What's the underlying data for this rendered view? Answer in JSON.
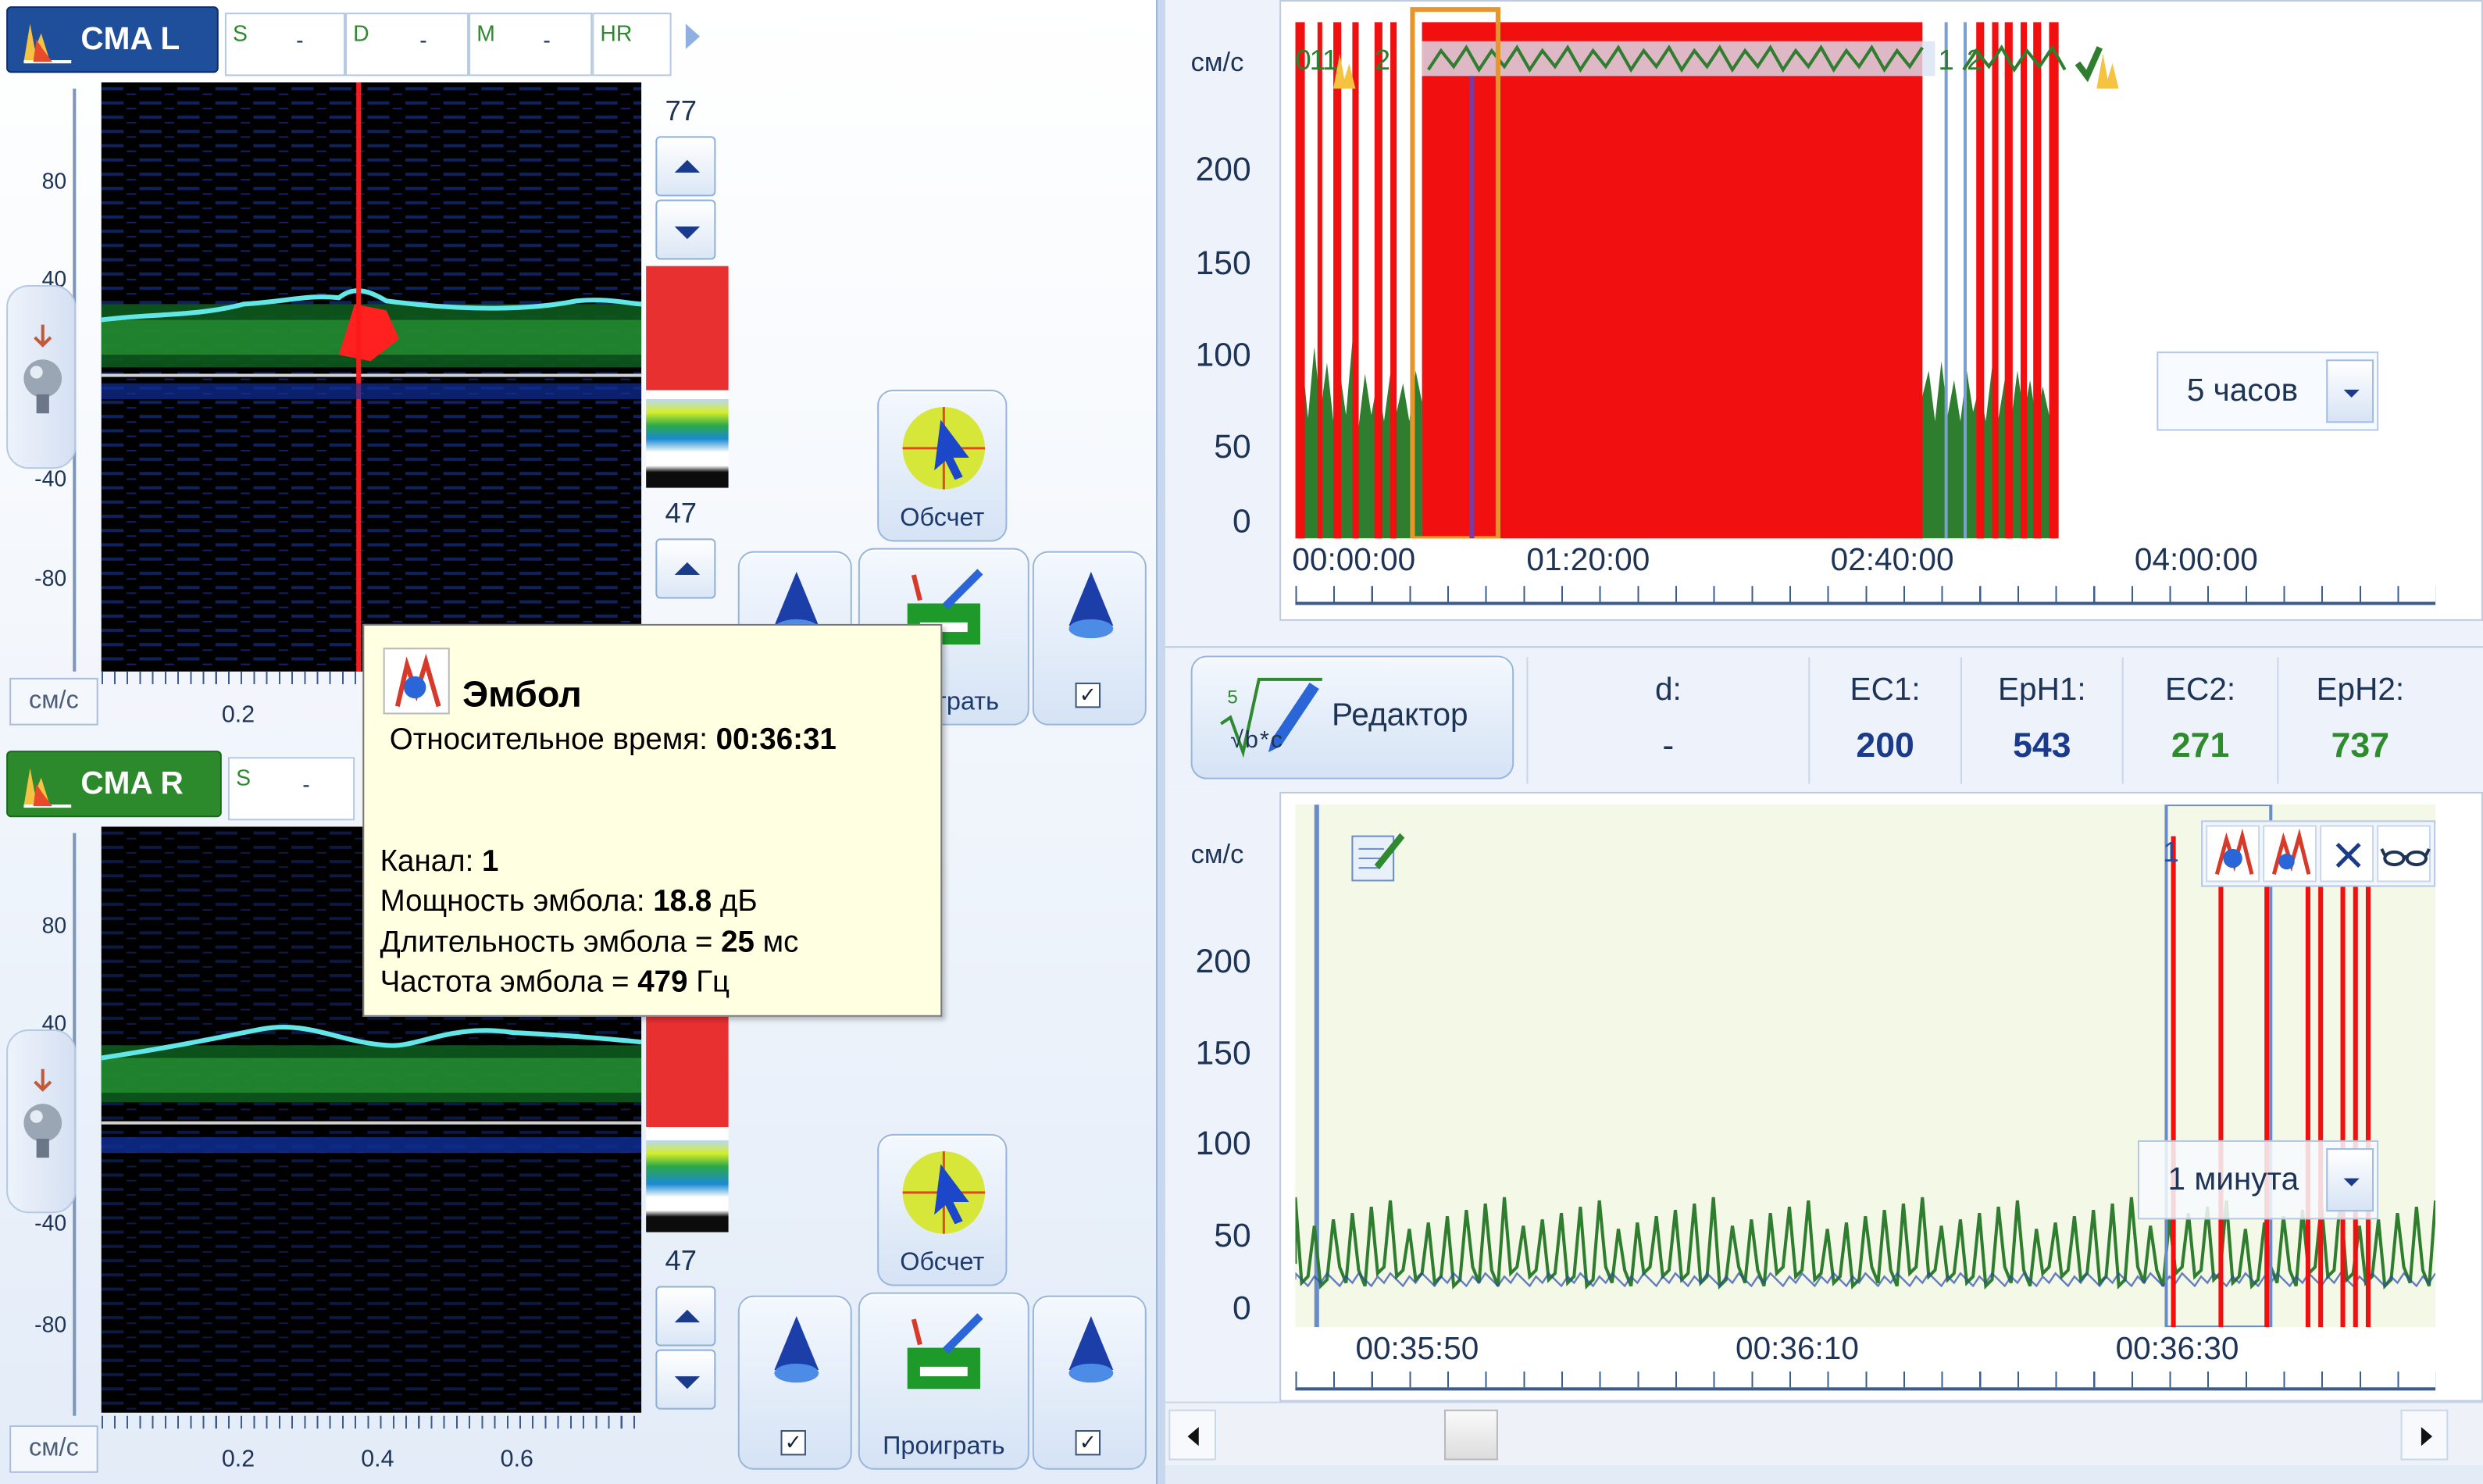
{
  "left": {
    "top_channel": {
      "tab_label": "CMA L",
      "params": [
        {
          "key": "S",
          "value": "-"
        },
        {
          "key": "D",
          "value": "-"
        },
        {
          "key": "M",
          "value": "-"
        },
        {
          "key": "HR",
          "value": ""
        }
      ],
      "y_ticks": [
        "80",
        "40",
        "-40",
        "-80"
      ],
      "x_ticks": [
        "0.2"
      ],
      "unit": "см/с",
      "scale_max": "77",
      "scale_min": "47"
    },
    "bottom_channel": {
      "tab_label": "CMA R",
      "params": [
        {
          "key": "S",
          "value": "-"
        }
      ],
      "y_ticks": [
        "80",
        "40",
        "-40",
        "-80"
      ],
      "x_ticks": [
        "0.2",
        "0.4",
        "0.6"
      ],
      "unit": "см/с",
      "scale_min": "47"
    },
    "buttons": {
      "count_label": "Обсчет",
      "play_label": "Проиграть",
      "play_label_partial": "играть"
    }
  },
  "tooltip": {
    "title": "Эмбол",
    "relative_time_label": "Относительное время:",
    "relative_time_value": "00:36:31",
    "channel_label": "Канал:",
    "channel_value": "1",
    "power_label": "Мощность эмбола:",
    "power_value": "18.8",
    "power_unit": "дБ",
    "duration_label": "Длительность эмбола =",
    "duration_value": "25",
    "duration_unit": "мс",
    "frequency_label": "Частота эмбола =",
    "frequency_value": "479",
    "frequency_unit": "Гц"
  },
  "overview_chart": {
    "unit": "см/с",
    "y_ticks": [
      "200",
      "150",
      "100",
      "50",
      "0"
    ],
    "x_ticks": [
      "00:00:00",
      "01:20:00",
      "02:40:00",
      "04:00:00"
    ],
    "range_select": "5 часов",
    "marker_labels": [
      "0",
      "1",
      "1",
      "2",
      "1",
      "2"
    ]
  },
  "editor": {
    "label": "Редактор",
    "formula": "√b*c",
    "formula_index": "5"
  },
  "stats": [
    {
      "key": "d:",
      "value": "-",
      "color": "#1e3456"
    },
    {
      "key": "EC1:",
      "value": "200",
      "color": "#1a3a8c"
    },
    {
      "key": "EpH1:",
      "value": "543",
      "color": "#1a3a8c"
    },
    {
      "key": "EC2:",
      "value": "271",
      "color": "#2e8b2e"
    },
    {
      "key": "EpH2:",
      "value": "737",
      "color": "#2e8b2e"
    }
  ],
  "detail_chart": {
    "unit": "см/с",
    "y_ticks": [
      "200",
      "150",
      "100",
      "50",
      "0"
    ],
    "x_ticks": [
      "00:35:50",
      "00:36:10",
      "00:36:30"
    ],
    "range_select": "1 минута",
    "marker_label": "1"
  }
}
